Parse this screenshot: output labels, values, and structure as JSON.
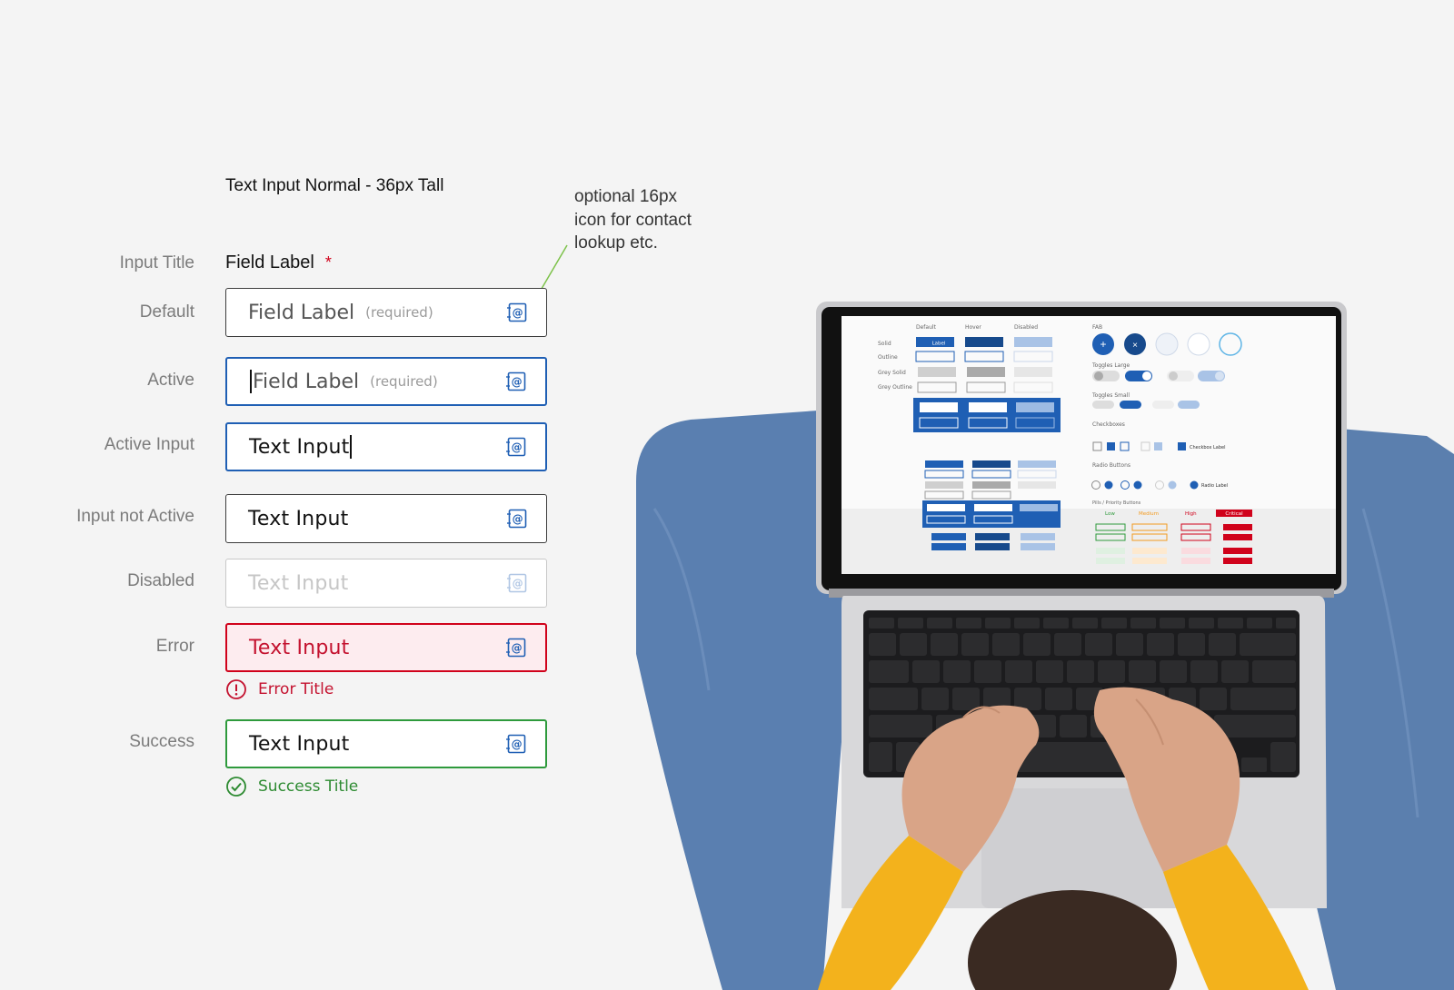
{
  "spec": {
    "title": "Text Input Normal - 36px Tall",
    "note": [
      "optional 16px",
      "icon for contact",
      "lookup etc."
    ],
    "field_label": "Field Label",
    "required_marker": "*",
    "rows": {
      "input_title": "Input Title",
      "default": "Default",
      "active": "Active",
      "active_input": "Active Input",
      "input_not_active": "Input not Active",
      "disabled": "Disabled",
      "error": "Error",
      "success": "Success"
    },
    "inputs": {
      "default_placeholder": "Field Label",
      "default_hint": "(required)",
      "active_placeholder": "Field Label",
      "active_hint": "(required)",
      "active_input_value": "Text Input",
      "not_active_value": "Text Input",
      "disabled_value": "Text Input",
      "error_value": "Text Input",
      "success_value": "Text Input"
    },
    "messages": {
      "error_title": "Error Title",
      "success_title": "Success Title"
    },
    "icon": "contact-lookup-icon"
  },
  "screen": {
    "col_default": "Default",
    "col_hover": "Hover",
    "col_disabled": "Disabled",
    "fab": "FAB",
    "toggles_large": "Toggles Large",
    "toggles_small": "Toggles Small",
    "checkboxes": "Checkboxes",
    "radio_buttons": "Radio Buttons",
    "pills": "Pills / Priority Buttons",
    "button_label": "Label",
    "checkbox_label": "Checkbox Label",
    "radio_label": "Radio Label",
    "priority": [
      "Low",
      "Medium",
      "High",
      "Critical"
    ],
    "row_solid": "Solid",
    "row_outline": "Outline",
    "row_grey_solid": "Grey Solid",
    "row_grey_outline": "Grey Outline"
  },
  "colors": {
    "accent": "#1f5fb4",
    "error": "#d0021b",
    "success": "#2e9a3c"
  }
}
